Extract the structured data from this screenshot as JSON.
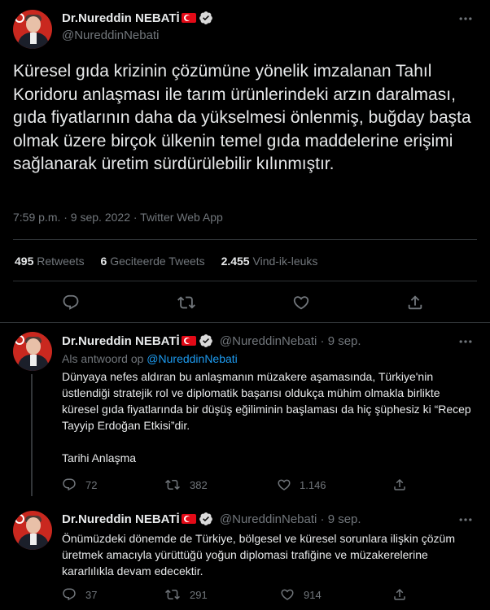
{
  "main_tweet": {
    "author_name": "Dr.Nureddin NEBATİ",
    "handle": "@NureddinNebati",
    "text": "Küresel gıda krizinin çözümüne yönelik imzalanan Tahıl Koridoru anlaşması ile tarım ürünlerindeki arzın daralması, gıda fiyatlarının daha da yükselmesi önlenmiş, buğday başta olmak üzere birçok ülkenin temel gıda maddelerine erişimi sağlanarak üretim sürdürülebilir kılınmıştır.",
    "meta": "7:59 p.m. · 9 sep. 2022 · Twitter Web App",
    "stats": {
      "retweets_count": "495",
      "retweets_label": "Retweets",
      "quotes_count": "6",
      "quotes_label": "Geciteerde Tweets",
      "likes_count": "2.455",
      "likes_label": "Vind-ik-leuks"
    }
  },
  "replies": [
    {
      "author_name": "Dr.Nureddin NEBATİ",
      "handle_date": "@NureddinNebati · 9 sep.",
      "reply_prefix": "Als antwoord op",
      "reply_handle": "@NureddinNebati",
      "text_p1": "Dünyaya nefes aldıran bu anlaşmanın müzakere aşamasında, Türkiye'nin üstlendiği stratejik rol ve diplomatik başarısı oldukça mühim olmakla birlikte küresel gıda fiyatlarında bir düşüş eğiliminin başlaması da hiç şüphesiz ki “Recep Tayyip Erdoğan Etkisi”dir.",
      "text_p2": "Tarihi Anlaşma",
      "replies_count": "72",
      "retweets_count": "382",
      "likes_count": "1.146"
    },
    {
      "author_name": "Dr.Nureddin NEBATİ",
      "handle_date": "@NureddinNebati · 9 sep.",
      "text_p1": "Önümüzdeki dönemde de Türkiye, bölgesel ve küresel sorunlara ilişkin çözüm üretmek amacıyla yürüttüğü yoğun diplomasi trafiğine ve müzakerelerine kararlılıkla devam edecektir.",
      "replies_count": "37",
      "retweets_count": "291",
      "likes_count": "914"
    }
  ],
  "colors": {
    "background": "#000000",
    "text": "#e7e9ea",
    "muted": "#71767b",
    "link": "#1d9bf0",
    "divider": "#2f3336",
    "flag_red": "#e30a17"
  },
  "icons": [
    "more-icon",
    "verified-badge-icon",
    "turkish-flag-icon",
    "reply-icon",
    "retweet-icon",
    "like-icon",
    "share-icon"
  ]
}
